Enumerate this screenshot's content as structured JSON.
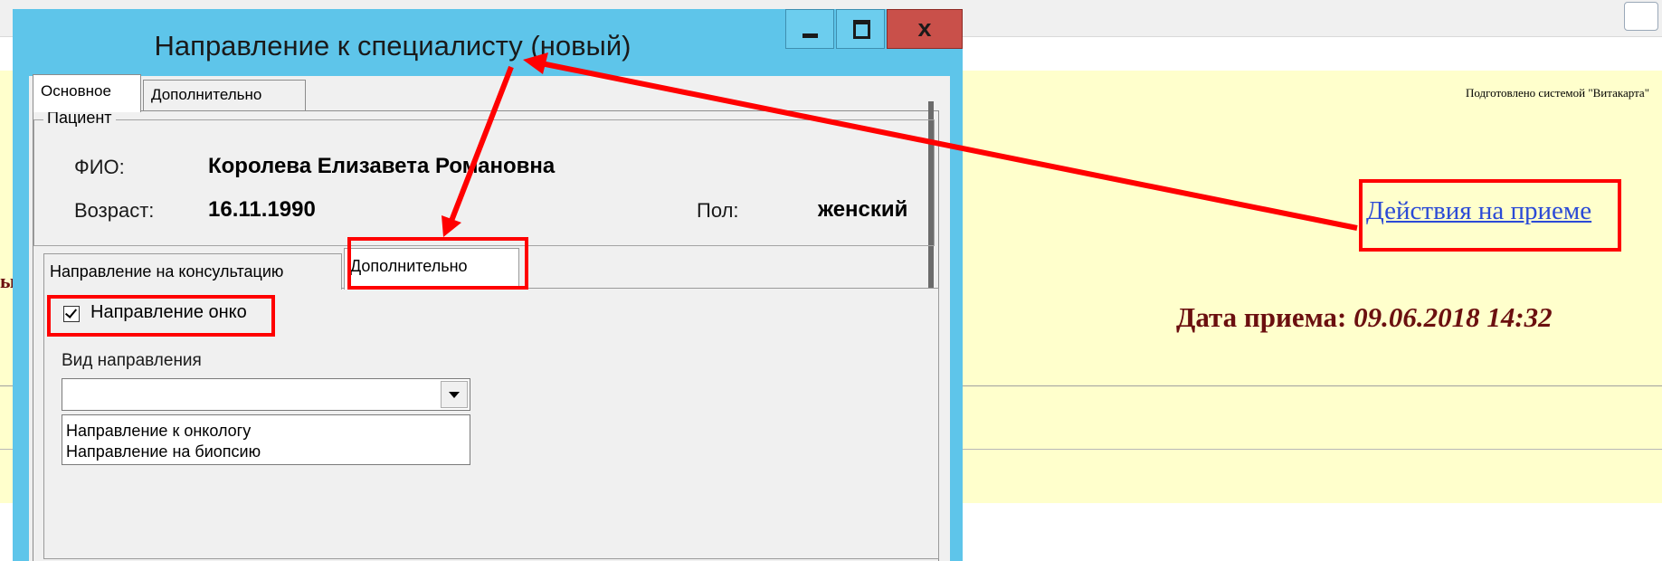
{
  "background_page": {
    "prepared_by": "Подготовлено системой \"Витакарта\"",
    "actions_link": "Действия на приеме",
    "visit_date_label": "Дата приема:",
    "visit_date_value": "09.06.2018 14:32",
    "cut_fragment": "ы"
  },
  "dialog": {
    "title": "Направление к специалисту (новый)",
    "close_glyph": "x",
    "tabs": [
      {
        "label": "Основное",
        "selected": true
      },
      {
        "label": "Дополнительно",
        "selected": false
      }
    ],
    "patient": {
      "group_label": "Пациент",
      "fio_label": "ФИО:",
      "fio_value": "Королева Елизавета Романовна",
      "age_label": "Возраст:",
      "age_value": "16.11.1990",
      "sex_label": "Пол:",
      "sex_value": "женский"
    },
    "sub_tabs": [
      {
        "label": "Направление на консультацию",
        "selected": false
      },
      {
        "label": "Дополнительно",
        "selected": true
      }
    ],
    "onko_checkbox": {
      "label": "Направление онко",
      "checked": true
    },
    "referral_type": {
      "label": "Вид направления",
      "value": "",
      "options": [
        "Направление к онкологу",
        "Направление на биопсию"
      ]
    }
  },
  "colors": {
    "titlebar": "#5ec5ea",
    "close_button": "#c9504a",
    "annotation": "#ff0000",
    "page_yellow": "#ffffcc",
    "link": "#2b4ad6",
    "date_text": "#6b0f0f"
  }
}
